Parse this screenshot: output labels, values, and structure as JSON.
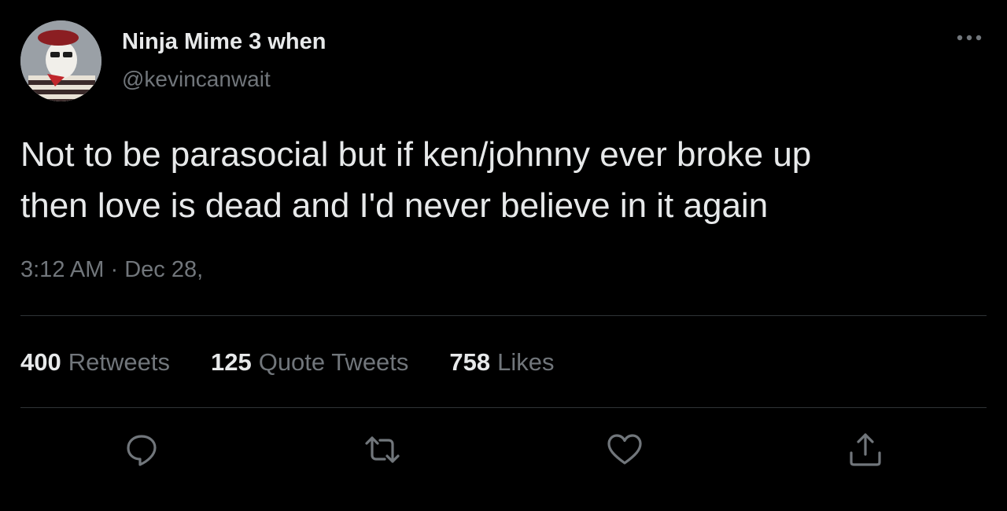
{
  "author": {
    "display_name": "Ninja Mime 3 when",
    "handle": "@kevincanwait"
  },
  "tweet": {
    "text": "Not to be parasocial but if ken/johnny ever broke up\nthen love is dead and I'd never believe in it again",
    "time": "3:12 AM",
    "separator": "·",
    "date": "Dec 28,"
  },
  "stats": {
    "retweets": {
      "count": "400",
      "label": "Retweets"
    },
    "quote_tweets": {
      "count": "125",
      "label": "Quote Tweets"
    },
    "likes": {
      "count": "758",
      "label": "Likes"
    }
  },
  "icons": {
    "more": "more-horizontal-icon",
    "reply": "reply-icon",
    "retweet": "retweet-icon",
    "like": "heart-icon",
    "share": "share-icon"
  },
  "colors": {
    "background": "#000000",
    "primary_text": "#e7e9ea",
    "secondary_text": "#71767b",
    "divider": "#2f3336"
  }
}
